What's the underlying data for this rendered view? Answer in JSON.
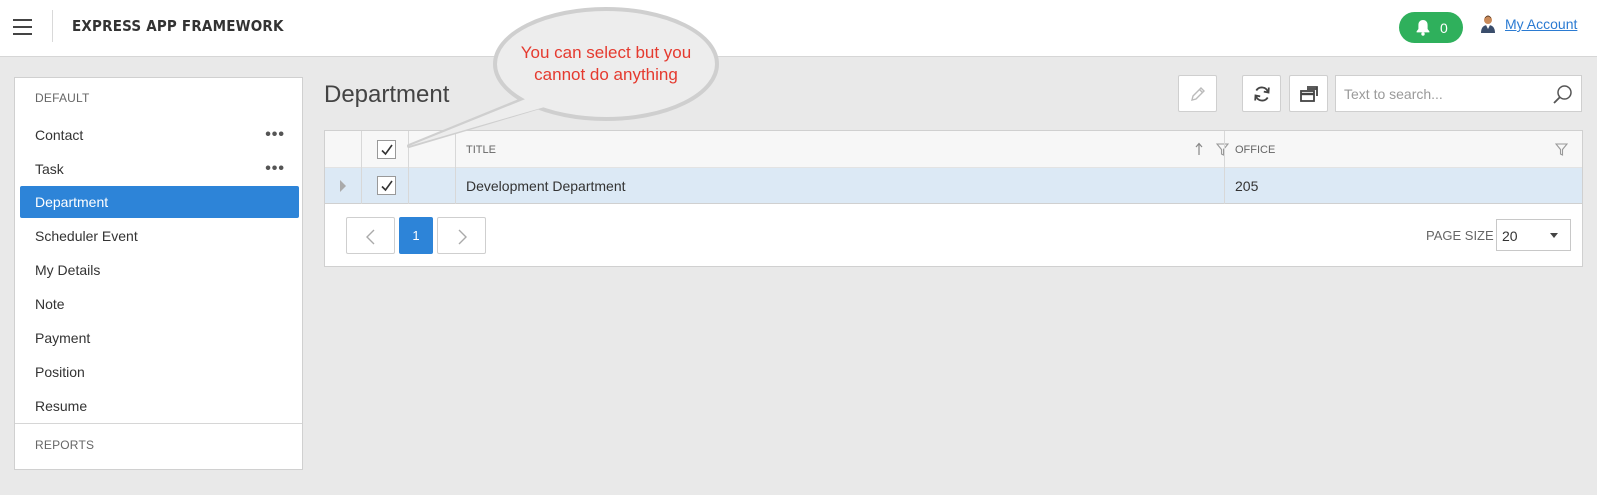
{
  "header": {
    "app_title": "EXPRESS APP FRAMEWORK",
    "notification_count": "0",
    "account_label": "My Account"
  },
  "sidebar": {
    "group_default": "DEFAULT",
    "items": [
      {
        "label": "Contact",
        "has_menu": true
      },
      {
        "label": "Task",
        "has_menu": true
      },
      {
        "label": "Department",
        "active": true
      },
      {
        "label": "Scheduler Event"
      },
      {
        "label": "My Details"
      },
      {
        "label": "Note"
      },
      {
        "label": "Payment"
      },
      {
        "label": "Position"
      },
      {
        "label": "Resume"
      }
    ],
    "menu_dots": "•••",
    "group_reports": "REPORTS"
  },
  "main": {
    "page_title": "Department",
    "search_placeholder": "Text to search..."
  },
  "grid": {
    "columns": [
      "TITLE",
      "OFFICE"
    ],
    "rows": [
      {
        "title": "Development Department",
        "office": "205",
        "selected": true
      }
    ],
    "header_checked": true
  },
  "pager": {
    "current_page": "1",
    "page_size_label": "PAGE SIZE",
    "page_size_value": "20"
  },
  "annotation": {
    "text": "You can select but you cannot do anything",
    "color": "#e53a2f"
  },
  "colors": {
    "accent": "#2d84d8",
    "notification": "#2fb05c"
  }
}
